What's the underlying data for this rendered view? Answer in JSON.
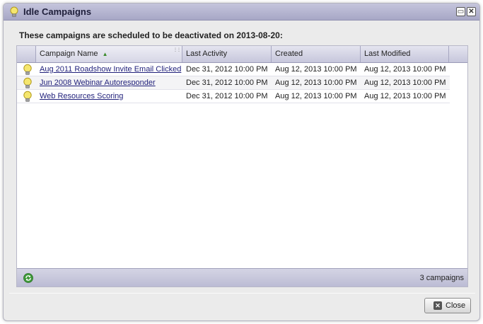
{
  "window": {
    "title": "Idle Campaigns"
  },
  "heading": "These campaigns are scheduled to be deactivated on 2013-08-20:",
  "table": {
    "columns": [
      "Campaign Name",
      "Last Activity",
      "Created",
      "Last Modified"
    ],
    "sort_column": "Campaign Name",
    "sort_direction": "ascending",
    "rows": [
      {
        "name": "Aug 2011 Roadshow Invite Email Clicked",
        "last_activity": "Dec 31, 2012 10:00 PM",
        "created": "Aug 12, 2013 10:00 PM",
        "last_modified": "Aug 12, 2013 10:00 PM",
        "icon": "lightbulb-icon"
      },
      {
        "name": "Jun 2008 Webinar Autoresponder",
        "last_activity": "Dec 31, 2012 10:00 PM",
        "created": "Aug 12, 2013 10:00 PM",
        "last_modified": "Aug 12, 2013 10:00 PM",
        "icon": "lightbulb-icon"
      },
      {
        "name": "Web Resources Scoring",
        "last_activity": "Dec 31, 2012 10:00 PM",
        "created": "Aug 12, 2013 10:00 PM",
        "last_modified": "Aug 12, 2013 10:00 PM",
        "icon": "lightbulb-icon"
      }
    ]
  },
  "footer": {
    "count": "3 campaigns",
    "refresh_icon": "refresh-icon"
  },
  "buttons": {
    "close": "Close"
  },
  "colors": {
    "titlebar": "#b5b5d0",
    "link": "#1f1f7a",
    "bulb": "#f3e36a"
  }
}
